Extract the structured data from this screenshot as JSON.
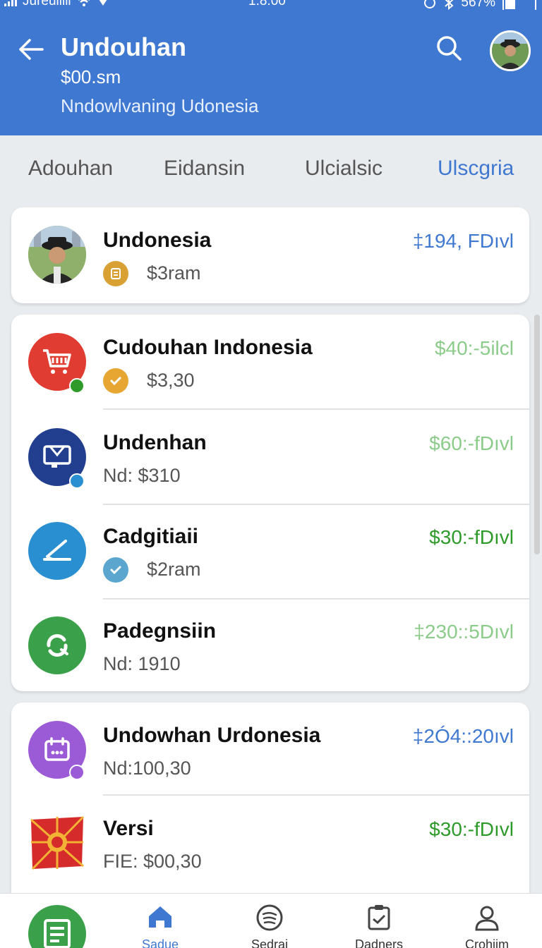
{
  "status_bar": {
    "carrier": "Jureuiiiii",
    "time": "1.8.00",
    "battery": "567%"
  },
  "header": {
    "title": "Undouhan",
    "subtitle": "$00.sm",
    "location": "Nndowlvaning Udonesia"
  },
  "tabs": [
    {
      "label": "Adouhan",
      "active": false
    },
    {
      "label": "Eidansin",
      "active": false
    },
    {
      "label": "Ulcialsic",
      "active": false
    },
    {
      "label": "Ulscgria",
      "active": true
    }
  ],
  "profile_card": {
    "title": "Undonesia",
    "sub": "$3ram",
    "amount": "‡194, FDıvl",
    "amount_color": "#3f78d1"
  },
  "list_card": [
    {
      "title": "Cudouhan Indonesia",
      "sub": "$3,30",
      "amount": "$40:-5ilcl",
      "amount_color": "#8ccc8a",
      "icon": "cart-icon",
      "color": "#e03c31"
    },
    {
      "title": "Undenhan",
      "sub": "Nd: $310",
      "amount": "$60:-fDıvl",
      "amount_color": "#8ccc8a",
      "icon": "screen-icon",
      "color": "#223e8f"
    },
    {
      "title": "Cadgitiaii",
      "sub": "$2ram",
      "amount": "$30:-fDıvl",
      "amount_color": "#2e9a2a",
      "icon": "pen-icon",
      "color": "#2a8fd0"
    },
    {
      "title": "Padegnsiin",
      "sub": "Nd: 1910",
      "amount": "‡230::5Dıvl",
      "amount_color": "#8ccc8a",
      "icon": "refresh-icon",
      "color": "#3aa04a"
    }
  ],
  "bottom_card": [
    {
      "title": "Undowhan Urdonesia",
      "sub": "Nd:100,30",
      "amount": "‡2Ó4::20ıvl",
      "amount_color": "#3f78d1",
      "icon": "calendar-icon",
      "color": "#9b5bd6"
    },
    {
      "title": "Versi",
      "sub": "FIE: $00,30",
      "amount": "$30:-fDıvl",
      "amount_color": "#2e9a2a",
      "icon": "flag-icon",
      "color": "#d62b2b"
    }
  ],
  "bottom_nav": [
    {
      "label": "Sadue",
      "active": true,
      "icon": "home-icon"
    },
    {
      "label": "Sedrai",
      "active": false,
      "icon": "music-icon"
    },
    {
      "label": "Dadners",
      "active": false,
      "icon": "clipboard-icon"
    },
    {
      "label": "Crohiim",
      "active": false,
      "icon": "person-icon"
    }
  ]
}
